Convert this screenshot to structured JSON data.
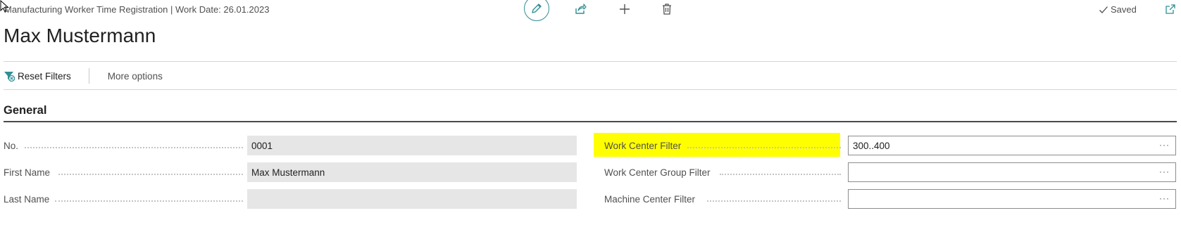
{
  "header": {
    "breadcrumb": "Manufacturing Worker Time Registration | Work Date: 26.01.2023",
    "saved_label": "Saved"
  },
  "icons": {
    "edit": "pencil-icon",
    "share": "share-icon",
    "new": "plus-icon",
    "delete": "trash-icon",
    "saved": "checkmark-icon",
    "popout": "popout-icon"
  },
  "page": {
    "title": "Max Mustermann"
  },
  "toolbar": {
    "reset_filters_label": "Reset Filters",
    "more_options_label": "More options"
  },
  "general": {
    "section_title": "General",
    "left_fields": [
      {
        "label": "No.",
        "value": "0001"
      },
      {
        "label": "First Name",
        "value": "Max Mustermann"
      },
      {
        "label": "Last Name",
        "value": ""
      }
    ],
    "right_fields": [
      {
        "label": "Work Center Filter",
        "value": "300..400"
      },
      {
        "label": "Work Center Group Filter",
        "value": ""
      },
      {
        "label": "Machine Center Filter",
        "value": ""
      }
    ]
  },
  "colors": {
    "accent": "#2f8f93",
    "highlight": "#ffff00"
  }
}
